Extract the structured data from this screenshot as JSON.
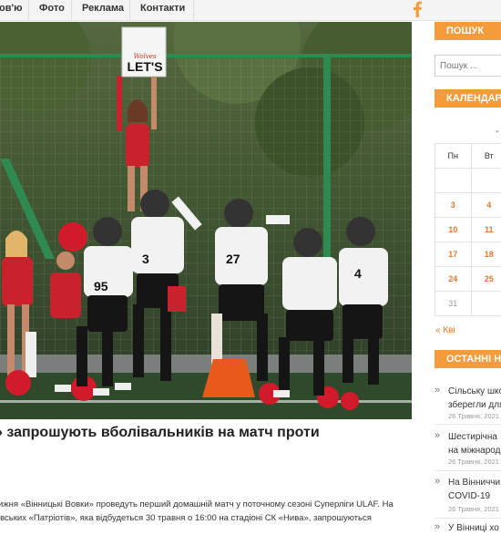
{
  "nav": {
    "items": [
      {
        "label": "ов'ю"
      },
      {
        "label": "Фото"
      },
      {
        "label": "Реклама"
      },
      {
        "label": "Контакти"
      }
    ],
    "social_icon": "facebook-icon"
  },
  "hero": {
    "sign_line1": "Wolves",
    "sign_line2": "LET'S",
    "jersey_numbers": [
      "95",
      "3",
      "27",
      "4"
    ]
  },
  "article": {
    "title": "» запрошують вболівальників на матч проти",
    "body_lines": [
      "ижня «Вінницькі Вовки» проведуть перший домашній матч у поточному сезоні Суперліги ULAF. На",
      "івських «Патріотів», яка відбудеться 30 травня о 16:00 на стадіоні СК «Нива», запрошуються"
    ]
  },
  "sidebar": {
    "search": {
      "heading": "ПОШУК",
      "placeholder": "Пошук ..."
    },
    "calendar": {
      "heading": "КАЛЕНДАР",
      "dash": "-",
      "weekdays": [
        "Пн",
        "Вт"
      ],
      "rows": [
        [
          "",
          ""
        ],
        [
          "3",
          "4"
        ],
        [
          "10",
          "11"
        ],
        [
          "17",
          "18"
        ],
        [
          "24",
          "25"
        ],
        [
          "31",
          ""
        ]
      ],
      "prev_link": "« Кві"
    },
    "recent": {
      "heading": "ОСТАННІ НО",
      "items": [
        {
          "title_lines": [
            "Сільську шко",
            "зберегли для"
          ],
          "date": "26 Травня, 2021"
        },
        {
          "title_lines": [
            "Шестирічна",
            "на міжнарод"
          ],
          "date": "26 Травня, 2021"
        },
        {
          "title_lines": [
            "На Вінниччи",
            "COVID-19"
          ],
          "date": "26 Травня, 2021"
        },
        {
          "title_lines": [
            "У Вінниці хо"
          ],
          "date": ""
        }
      ]
    }
  },
  "colors": {
    "accent_orange": "#f49b3b",
    "calendar_link": "#e8762b",
    "team_red": "#c8222c"
  }
}
